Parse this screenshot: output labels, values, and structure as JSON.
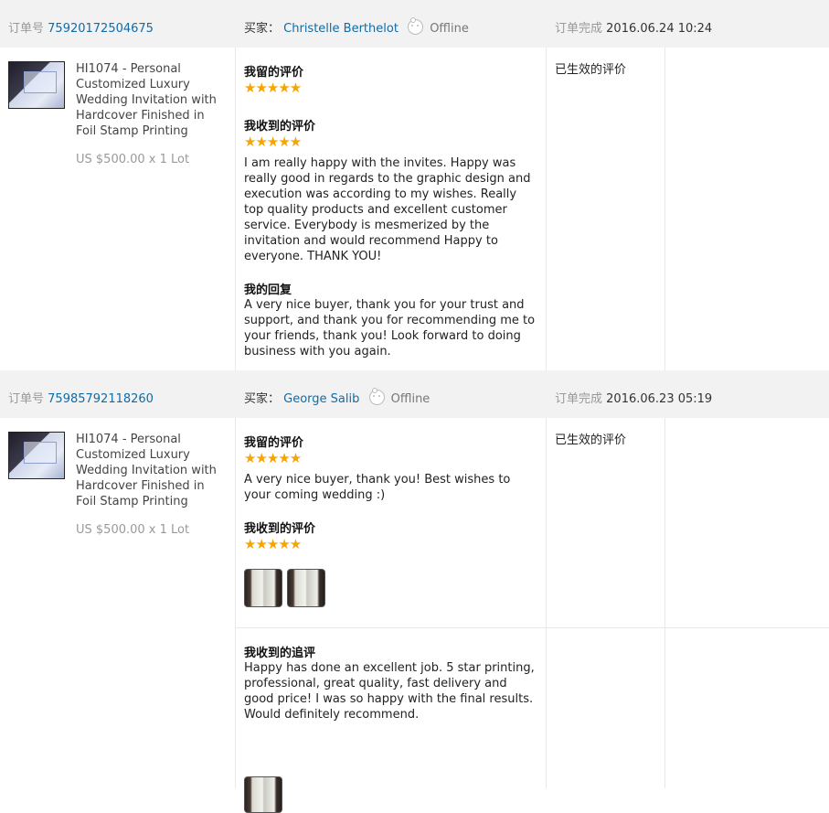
{
  "labels": {
    "order_no": "订单号",
    "buyer": "买家：",
    "completed": "订单完成",
    "my_review": "我留的评价",
    "received_review": "我收到的评价",
    "my_reply": "我的回复",
    "followup_review": "我收到的追评",
    "effective_review": "已生效的评价",
    "offline": "Offline",
    "stars": "★★★★★"
  },
  "orders": [
    {
      "order_id": "75920172504675",
      "buyer_name": "Christelle Berthelot",
      "completed_at": "2016.06.24 10:24",
      "product_title": "HI1074 - Personal Customized Luxury Wedding Invitation with Hardcover Finished in Foil Stamp Printing",
      "price": "US $500.00 x 1 Lot",
      "my_rating": 5,
      "received_rating": 5,
      "received_text": "I am really happy with the invites. Happy was really good in regards to the graphic design and execution was according to my wishes. Really top quality products and excellent customer service. Everybody is mesmerized by the invitation and would recommend Happy to everyone. THANK YOU!",
      "my_reply": "A very nice buyer, thank you for your trust and support, and thank you for recommending me to your friends, thank you! Look forward to doing business with you again."
    },
    {
      "order_id": "75985792118260",
      "buyer_name": "George Salib",
      "completed_at": "2016.06.23 05:19",
      "product_title": "HI1074 - Personal Customized Luxury Wedding Invitation with Hardcover Finished in Foil Stamp Printing",
      "price": "US $500.00 x 1 Lot",
      "my_rating": 5,
      "my_text": "A very nice buyer, thank you! Best wishes to your coming wedding :)",
      "received_rating": 5,
      "received_photos": 2,
      "followup_text": "Happy has done an excellent job. 5 star printing, professional, great quality, fast delivery and good price! I was so happy with the final results. Would definitely recommend.",
      "followup_photos": 1
    }
  ],
  "colors": {
    "link": "#0f6ca8",
    "star": "#f7a500",
    "header_bg": "#f2f2f2"
  }
}
